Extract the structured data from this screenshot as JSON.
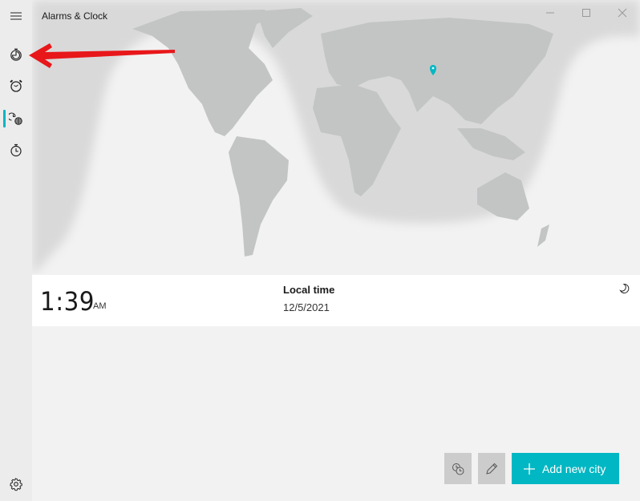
{
  "window": {
    "title": "Alarms & Clock",
    "controls": [
      "minimize",
      "maximize",
      "close"
    ]
  },
  "sidebar": {
    "items": [
      {
        "name": "menu",
        "icon": "hamburger-icon",
        "selected": false
      },
      {
        "name": "focus-sessions",
        "icon": "timer-icon",
        "selected": false
      },
      {
        "name": "alarm",
        "icon": "alarm-clock-icon",
        "selected": false
      },
      {
        "name": "world-clock",
        "icon": "world-clock-icon",
        "selected": true
      },
      {
        "name": "stopwatch",
        "icon": "stopwatch-icon",
        "selected": false
      }
    ],
    "settings_icon": "gear-icon"
  },
  "map": {
    "pin_icon": "location-pin-icon"
  },
  "local_clock": {
    "time": "1:39",
    "ampm": "AM",
    "city": "Local time",
    "date": "12/5/2021",
    "daynight_icon": "moon-icon"
  },
  "actions": {
    "compare_icon": "compare-clocks-icon",
    "edit_icon": "pencil-icon",
    "add_label": "Add new city"
  },
  "colors": {
    "accent": "#00b7c3",
    "annotation": "#e8171a"
  }
}
